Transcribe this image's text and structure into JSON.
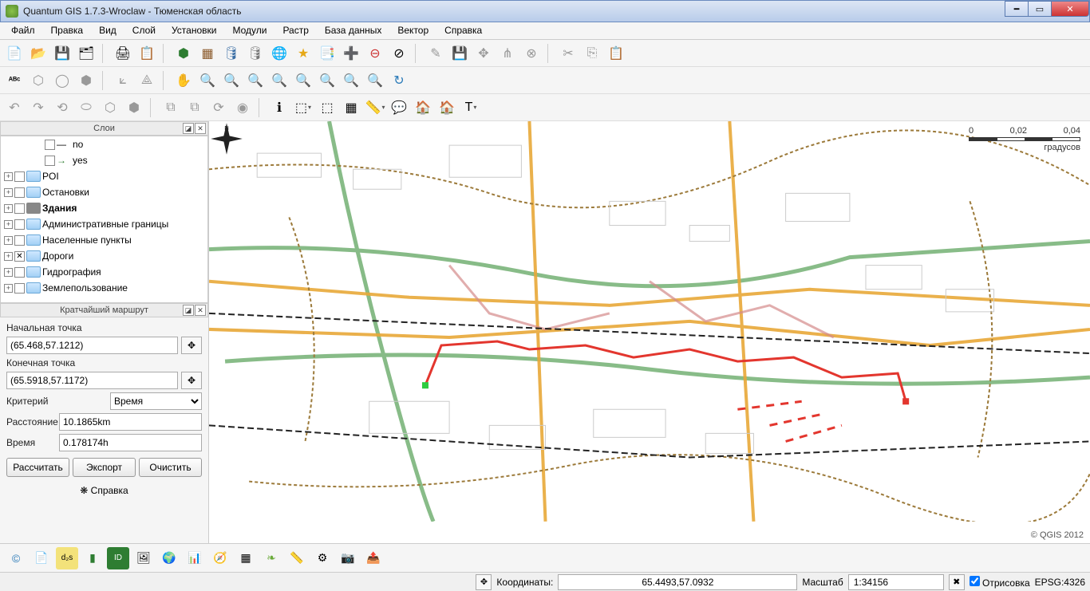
{
  "window": {
    "title": "Quantum GIS 1.7.3-Wroclaw - Тюменская область"
  },
  "menu": [
    "Файл",
    "Правка",
    "Вид",
    "Слой",
    "Установки",
    "Модули",
    "Растр",
    "База данных",
    "Вектор",
    "Справка"
  ],
  "panels": {
    "layers_title": "Слои",
    "route_title": "Кратчайший маршрут"
  },
  "layers": [
    {
      "indent": 2,
      "exp": false,
      "chk": false,
      "icon": "line",
      "label": "no"
    },
    {
      "indent": 2,
      "exp": false,
      "chk": false,
      "icon": "arrow",
      "label": "yes"
    },
    {
      "indent": 0,
      "exp": true,
      "chk": true,
      "icon": "folder",
      "label": "POI"
    },
    {
      "indent": 0,
      "exp": true,
      "chk": true,
      "icon": "folder",
      "label": "Остановки"
    },
    {
      "indent": 0,
      "exp": true,
      "chk": true,
      "icon": "build",
      "label": "Здания",
      "bold": true
    },
    {
      "indent": 0,
      "exp": true,
      "chk": true,
      "icon": "folder",
      "label": "Административные границы"
    },
    {
      "indent": 0,
      "exp": true,
      "chk": true,
      "icon": "folder",
      "label": "Населенные пункты"
    },
    {
      "indent": 0,
      "exp": true,
      "chk": true,
      "icon": "folder",
      "label": "Дороги",
      "chkon": true
    },
    {
      "indent": 0,
      "exp": true,
      "chk": true,
      "icon": "folder",
      "label": "Гидрография"
    },
    {
      "indent": 0,
      "exp": true,
      "chk": true,
      "icon": "folder",
      "label": "Землепользование"
    }
  ],
  "route": {
    "start_label": "Начальная точка",
    "start_value": "(65.468,57.1212)",
    "end_label": "Конечная точка",
    "end_value": "(65.5918,57.1172)",
    "criteria_label": "Критерий",
    "criteria_value": "Время",
    "distance_label": "Расстояние",
    "distance_value": "10.1865km",
    "time_label": "Время",
    "time_value": "0.178174h",
    "calc": "Рассчитать",
    "export": "Экспорт",
    "clear": "Очистить",
    "help": "Справка"
  },
  "map": {
    "scale_left": "0",
    "scale_mid": "0,02",
    "scale_right": "0,04",
    "scale_unit": "градусов",
    "copyright": "© QGIS 2012"
  },
  "status": {
    "coords_label": "Координаты:",
    "coords_value": "65.4493,57.0932",
    "scale_label": "Масштаб",
    "scale_value": "1:34156",
    "render_label": "Отрисовка",
    "epsg": "EPSG:4326"
  }
}
